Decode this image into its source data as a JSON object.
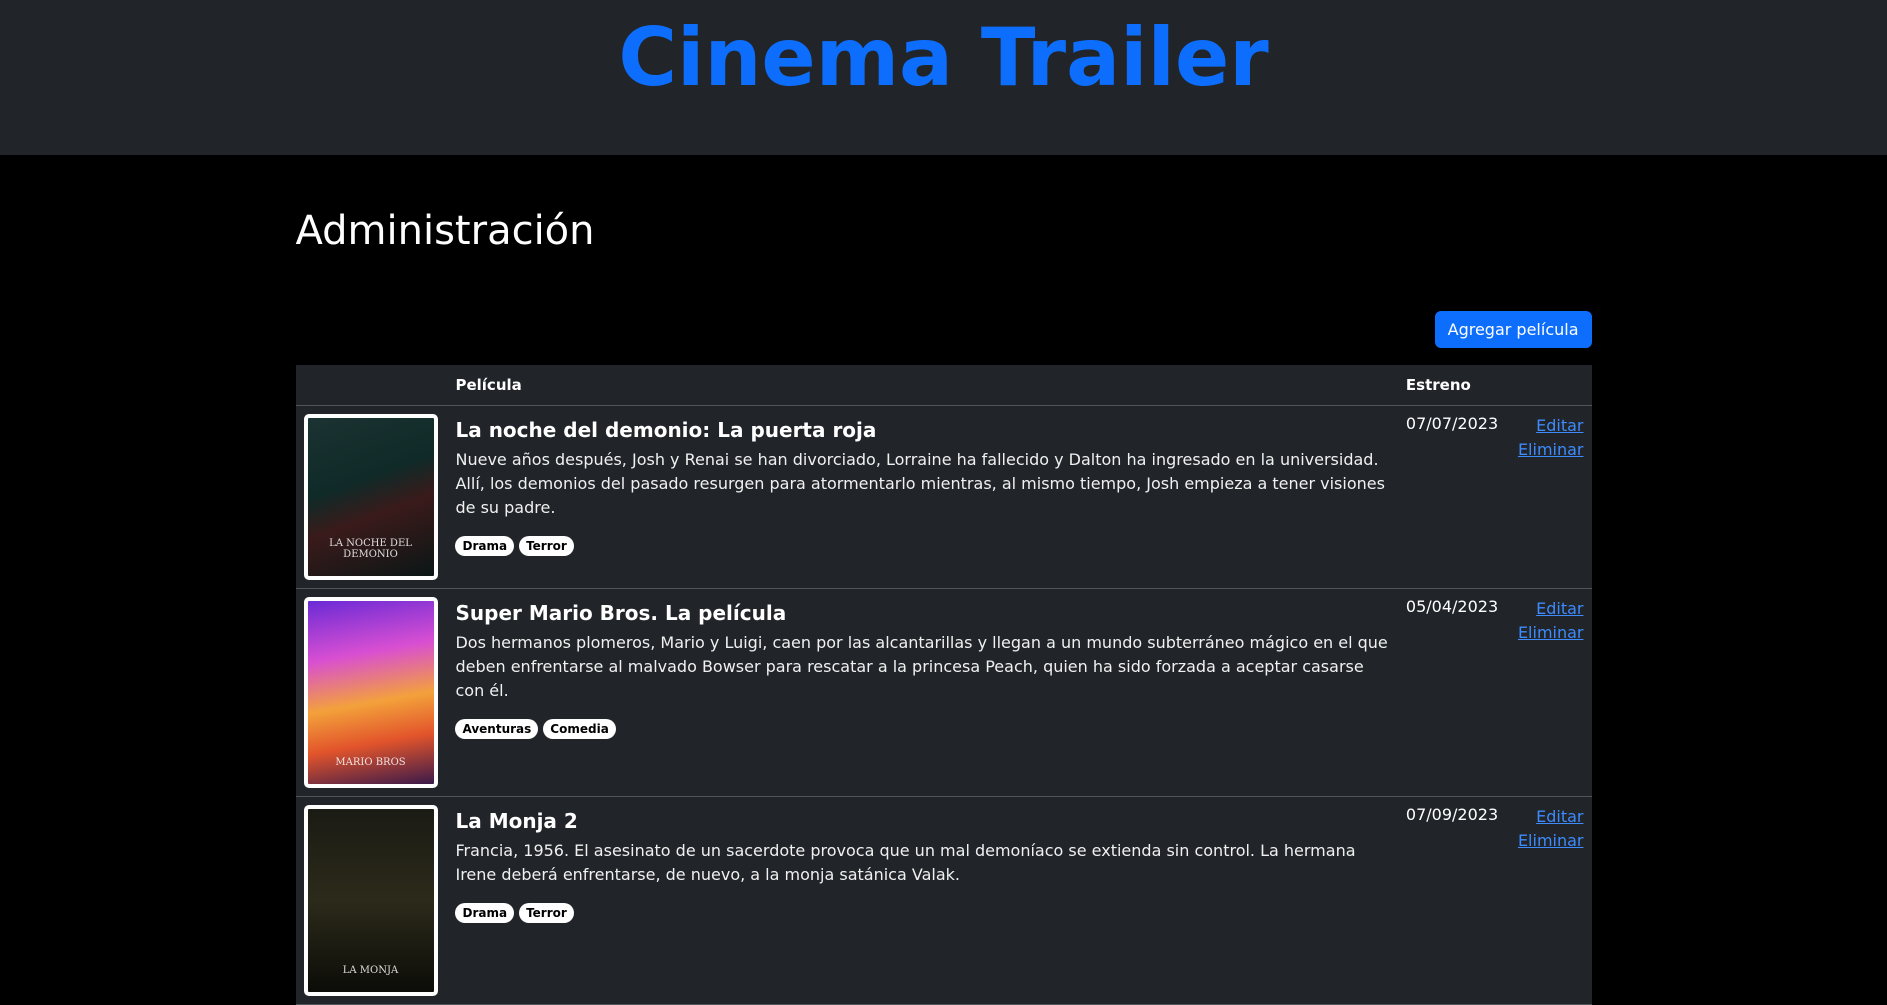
{
  "header": {
    "title": "Cinema Trailer"
  },
  "admin": {
    "title": "Administración",
    "add_button": "Agregar película"
  },
  "table": {
    "columns": {
      "poster": "",
      "movie": "Película",
      "release": "Estreno",
      "actions": ""
    },
    "edit_label": "Editar",
    "delete_label": "Eliminar",
    "rows": [
      {
        "title": "La noche del demonio: La puerta roja",
        "description": "Nueve años después, Josh y Renai se han divorciado, Lorraine ha fallecido y Dalton ha ingresado en la universidad. Allí, los demonios del pasado resurgen para atormentarlo mientras, al mismo tiempo, Josh empieza a tener visiones de su padre.",
        "tags": [
          "Drama",
          "Terror"
        ],
        "release": "07/07/2023",
        "poster_text": "LA NOCHE DEL DEMONIO"
      },
      {
        "title": "Super Mario Bros. La película",
        "description": "Dos hermanos plomeros, Mario y Luigi, caen por las alcantarillas y llegan a un mundo subterráneo mágico en el que deben enfrentarse al malvado Bowser para rescatar a la princesa Peach, quien ha sido forzada a aceptar casarse con él.",
        "tags": [
          "Aventuras",
          "Comedia"
        ],
        "release": "05/04/2023",
        "poster_text": "MARIO BROS"
      },
      {
        "title": "La Monja 2",
        "description": "Francia, 1956. El asesinato de un sacerdote provoca que un mal demoníaco se extienda sin control. La hermana Irene deberá enfrentarse, de nuevo, a la monja satánica Valak.",
        "tags": [
          "Drama",
          "Terror"
        ],
        "release": "07/09/2023",
        "poster_text": "LA MONJA"
      }
    ]
  }
}
